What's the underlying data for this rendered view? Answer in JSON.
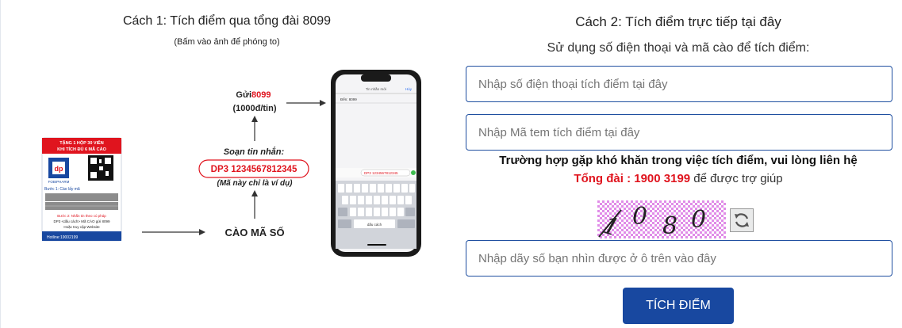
{
  "method1": {
    "title": "Cách 1: Tích điểm qua tổng đài 8099",
    "subtitle": "(Bấm vào ảnh để phóng to)",
    "image": {
      "send_prefix": "Gửi ",
      "send_number": "8099",
      "price": "(1000đ/tin)",
      "compose_label": "Soạn tin nhắn:",
      "sms_example": "DP3 1234567812345",
      "example_note": "(Mã này chỉ là ví dụ)",
      "scratch_label": "CÀO MÃ SỐ",
      "card_line1": "TẶNG 1 HỘP 30 VIÊN",
      "card_line2": "KHI TÍCH ĐỦ 6 MÃ CÀO",
      "card_brand": "FOBIPHARM",
      "card_step1": "Bước 1: Cào lấy mã",
      "card_hotline": "Hotline:19002199",
      "phone_header": "Tin nhắn mới"
    }
  },
  "method2": {
    "title": "Cách 2: Tích điểm trực tiếp tại đây",
    "subtitle": "Sử dụng số điện thoại và mã cào để tích điểm:",
    "phone_placeholder": "Nhập số điện thoại tích điểm tại đây",
    "code_placeholder": "Nhập Mã tem tích điểm tại đây",
    "help_text": "Trường hợp gặp khó khăn trong việc tích điểm, vui lòng liên hệ",
    "hotline_label": "Tổng đài : 1900 3199",
    "help_suffix": " để được trợ giúp",
    "captcha_text": "1080",
    "captcha_placeholder": "Nhập dãy số bạn nhìn được ở ô trên vào đây",
    "submit_label": "TÍCH ĐIỂM"
  },
  "colors": {
    "accent_blue": "#1848a0",
    "hotline_red": "#e0141e",
    "field_border": "#1f4fa0",
    "captcha_pink": "#e08ce8"
  },
  "icons": {
    "refresh": "refresh-icon",
    "arrow": "arrow-right-icon"
  }
}
